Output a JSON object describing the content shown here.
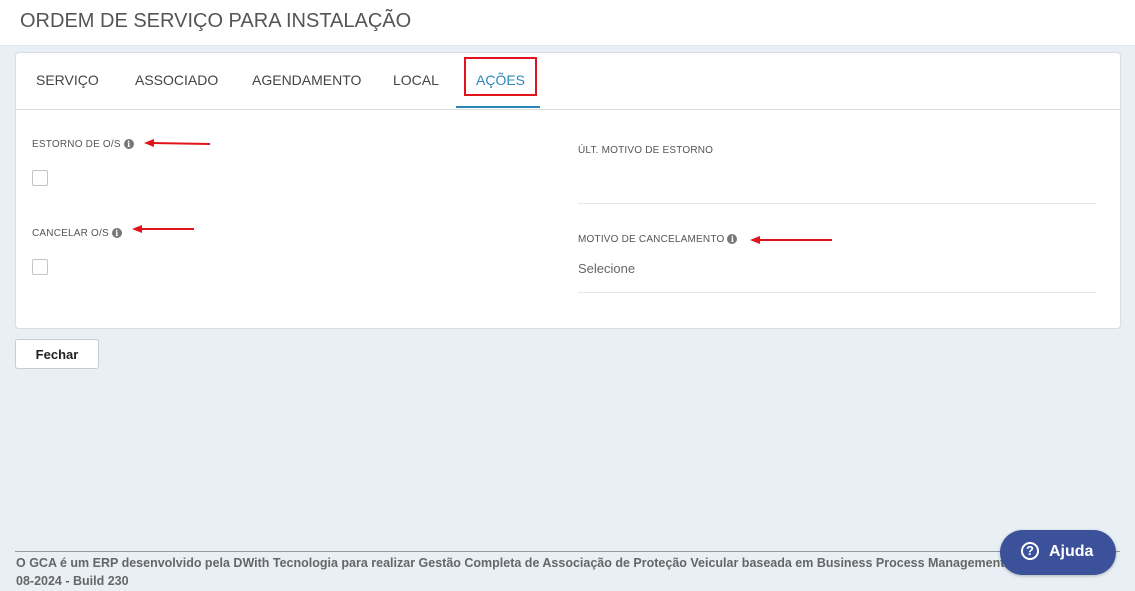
{
  "header": {
    "title": "ORDEM DE SERVIÇO PARA INSTALAÇÃO"
  },
  "tabs": [
    {
      "label": "SERVIÇO"
    },
    {
      "label": "ASSOCIADO"
    },
    {
      "label": "AGENDAMENTO"
    },
    {
      "label": "LOCAL"
    },
    {
      "label": "AÇÕES",
      "active": true
    }
  ],
  "form": {
    "estorno_label": "ESTORNO DE O/S",
    "cancelar_label": "CANCELAR O/S",
    "ult_motivo_label": "ÚLT. MOTIVO DE ESTORNO",
    "motivo_cancelamento_label": "MOTIVO DE CANCELAMENTO",
    "motivo_cancelamento_value": "Selecione",
    "estorno_checked": false,
    "cancelar_checked": false
  },
  "actions": {
    "close_label": "Fechar"
  },
  "footer": {
    "line1": "O GCA é um ERP desenvolvido pela DWith Tecnologia para realizar Gestão Completa de Associação de Proteção Veicular baseada em Business Process Management",
    "line2": "08-2024 - Build 230"
  },
  "help": {
    "label": "Ajuda",
    "icon": "?"
  },
  "info_icon": "i",
  "colors": {
    "accent": "#2c87b8",
    "highlight": "#e0141a",
    "help_button": "#3b5199",
    "background": "#e8eff5"
  }
}
